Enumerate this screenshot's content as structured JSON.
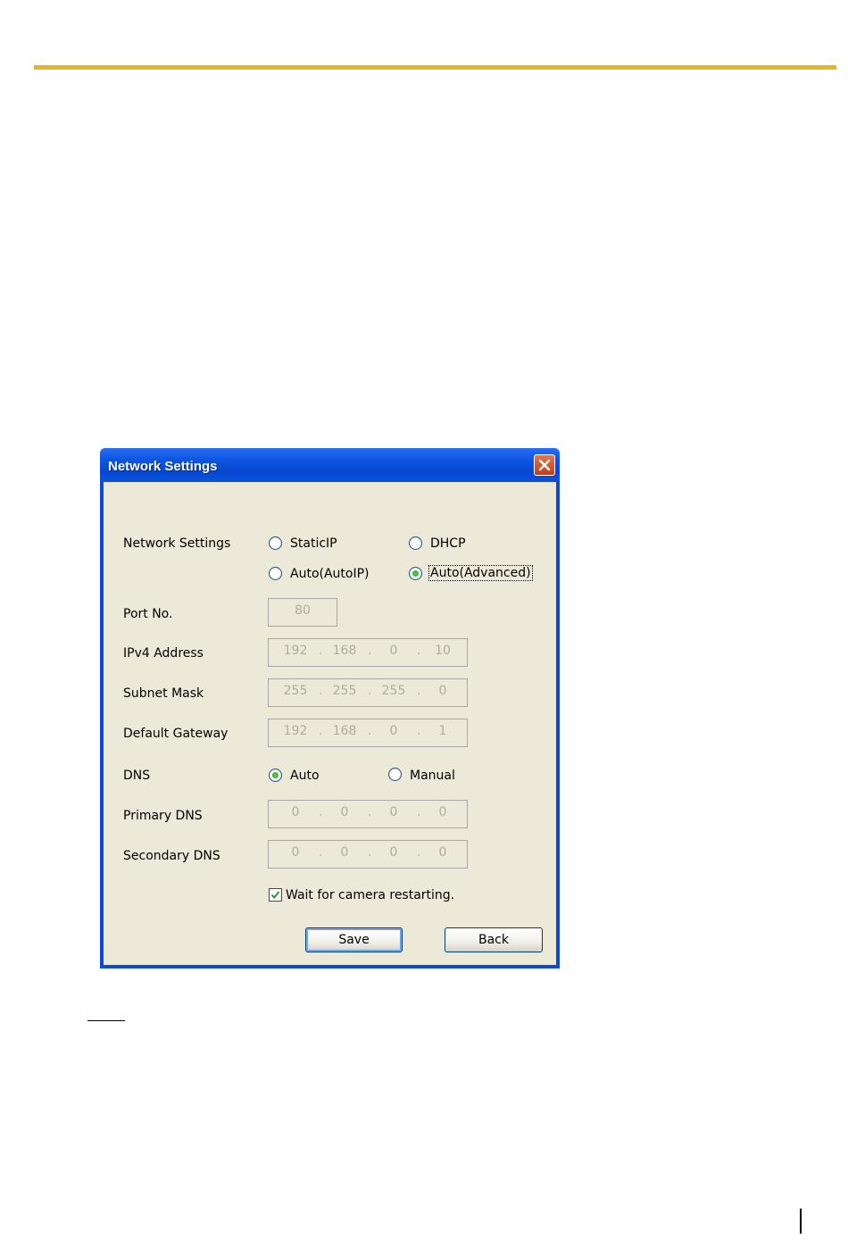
{
  "dialog": {
    "title": "Network Settings",
    "close_icon": "close-icon",
    "network_settings": {
      "label": "Network Settings",
      "options": [
        {
          "label": "StaticIP",
          "selected": false
        },
        {
          "label": "DHCP",
          "selected": false
        },
        {
          "label": "Auto(AutoIP)",
          "selected": false
        },
        {
          "label": "Auto(Advanced)",
          "selected": true
        }
      ]
    },
    "port": {
      "label": "Port No.",
      "value": "80"
    },
    "ipv4": {
      "label": "IPv4 Address",
      "octets": [
        "192",
        "168",
        "0",
        "10"
      ]
    },
    "subnet": {
      "label": "Subnet Mask",
      "octets": [
        "255",
        "255",
        "255",
        "0"
      ]
    },
    "gateway": {
      "label": "Default Gateway",
      "octets": [
        "192",
        "168",
        "0",
        "1"
      ]
    },
    "dns": {
      "label": "DNS",
      "options": [
        {
          "label": "Auto",
          "selected": true
        },
        {
          "label": "Manual",
          "selected": false
        }
      ]
    },
    "primary_dns": {
      "label": "Primary DNS",
      "octets": [
        "0",
        "0",
        "0",
        "0"
      ]
    },
    "secondary_dns": {
      "label": "Secondary DNS",
      "octets": [
        "0",
        "0",
        "0",
        "0"
      ]
    },
    "wait_checkbox": {
      "label": "Wait for camera restarting.",
      "checked": true
    },
    "save_label": "Save",
    "back_label": "Back"
  },
  "colors": {
    "top_rule": "#e0b92a",
    "title_bar": "#0b55e0",
    "dialog_body": "#ece9d8",
    "close_button": "#c43c16",
    "radio_selected": "#21a121"
  }
}
